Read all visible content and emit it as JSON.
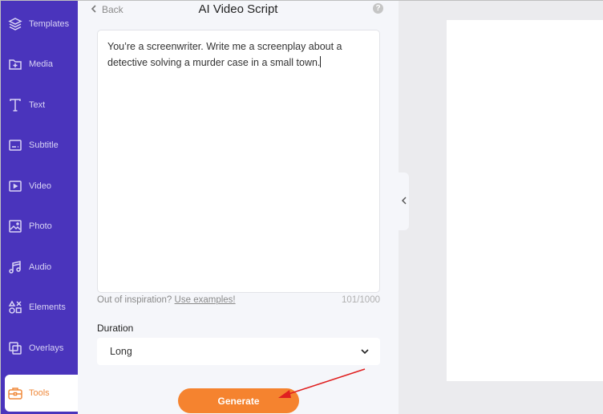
{
  "sidebar": {
    "items": [
      {
        "label": "Templates",
        "icon": "layers-icon"
      },
      {
        "label": "Media",
        "icon": "folder-plus-icon"
      },
      {
        "label": "Text",
        "icon": "text-icon"
      },
      {
        "label": "Subtitle",
        "icon": "subtitle-icon"
      },
      {
        "label": "Video",
        "icon": "video-icon"
      },
      {
        "label": "Photo",
        "icon": "photo-icon"
      },
      {
        "label": "Audio",
        "icon": "music-icon"
      },
      {
        "label": "Elements",
        "icon": "shapes-icon"
      },
      {
        "label": "Overlays",
        "icon": "overlays-icon"
      },
      {
        "label": "Tools",
        "icon": "toolbox-icon",
        "active": true
      }
    ]
  },
  "panel": {
    "back_label": "Back",
    "title": "AI Video Script",
    "help_glyph": "?",
    "prompt_text": "You’re a screenwriter. Write me a screenplay about a detective solving a murder case in a small town.",
    "hint_text": "Out of inspiration?",
    "hint_link": "Use examples!",
    "char_count": "101/1000",
    "duration_label": "Duration",
    "duration_value": "Long",
    "generate_label": "Generate"
  },
  "colors": {
    "sidebar": "#4a34bc",
    "accent": "#f5832f",
    "active_text": "#f08a3c",
    "annotation_arrow": "#e02020"
  }
}
